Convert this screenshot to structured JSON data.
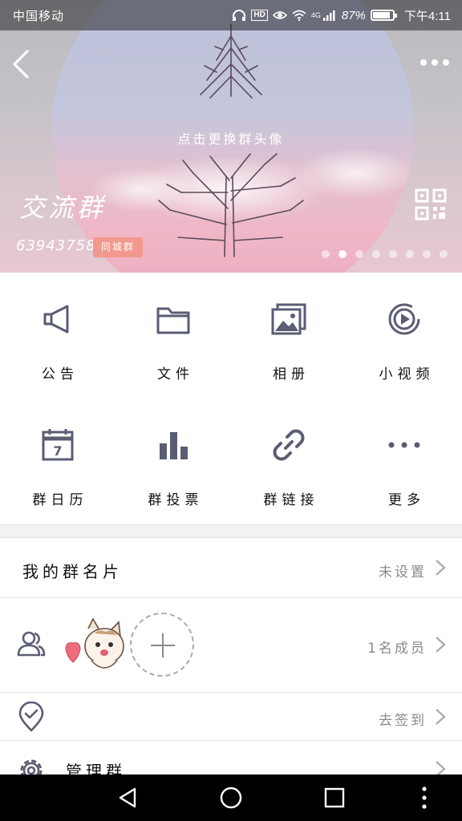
{
  "status_bar": {
    "carrier": "中国移动",
    "battery_pct": 87,
    "battery_text": "87%",
    "network": "4G",
    "hd_badge": "HD",
    "time": "下午4:11",
    "icons": [
      "headphones-icon",
      "hd-icon",
      "eye-icon",
      "wifi-icon",
      "signal-icon",
      "battery-icon"
    ]
  },
  "header": {
    "center_hint": "点击更换群头像",
    "group_name": "交流群",
    "group_id": "639437589",
    "badge": "同城群",
    "carousel": {
      "total": 8,
      "active_index": 1
    },
    "icons": {
      "back": "back-arrow-icon",
      "more": "more-dots-icon",
      "qr": "qr-code-icon"
    }
  },
  "grid": [
    {
      "label": "公告",
      "icon": "megaphone-icon"
    },
    {
      "label": "文件",
      "icon": "folder-icon"
    },
    {
      "label": "相册",
      "icon": "photo-album-icon"
    },
    {
      "label": "小视频",
      "icon": "video-play-icon"
    },
    {
      "label": "群日历",
      "icon": "calendar-icon",
      "icon_text": "7"
    },
    {
      "label": "群投票",
      "icon": "bar-chart-icon"
    },
    {
      "label": "群链接",
      "icon": "link-icon"
    },
    {
      "label": "更多",
      "icon": "more-horizontal-icon"
    }
  ],
  "rows": {
    "card": {
      "title": "我的群名片",
      "value": "未设置"
    },
    "members": {
      "value": "1名成员",
      "icon": "members-icon"
    },
    "checkin": {
      "value": "去签到",
      "icon": "location-check-icon"
    },
    "manage": {
      "title": "管理群",
      "icon": "gear-icon"
    }
  },
  "colors": {
    "badge": "#f1998e",
    "icon": "#5a5d73",
    "accent_pink": "#f0b6c6"
  }
}
